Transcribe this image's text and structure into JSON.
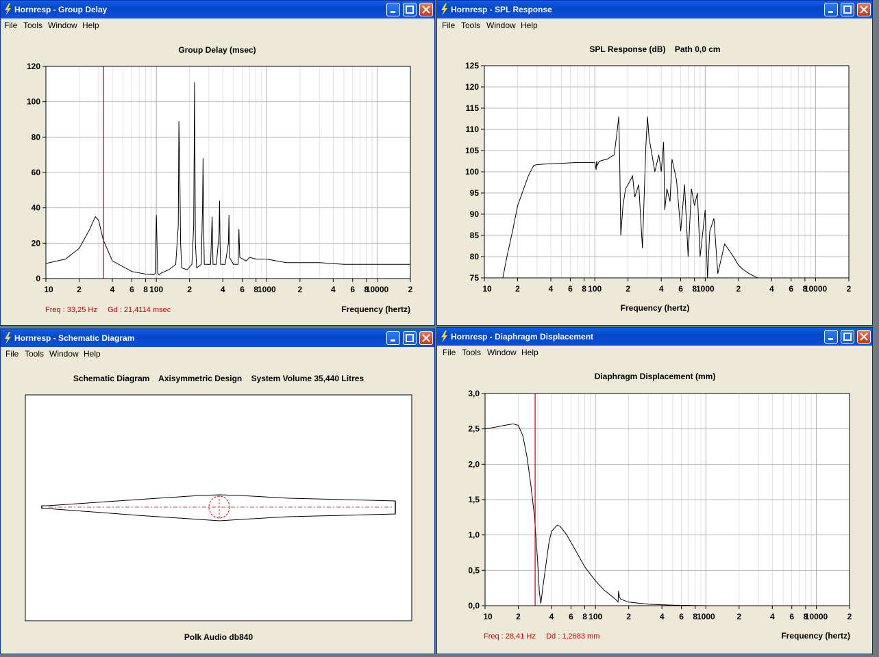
{
  "windows": {
    "gd": {
      "title": "Hornresp - Group Delay",
      "menu": [
        "File",
        "Tools",
        "Window",
        "Help"
      ],
      "chart_title": "Group Delay (msec)",
      "xlabel": "Frequency (hertz)",
      "y_ticks": [
        "120",
        "100",
        "80",
        "60",
        "40",
        "20",
        "0"
      ],
      "x_ticks": [
        "10",
        "2",
        "4",
        "6",
        "8",
        "100",
        "2",
        "4",
        "6",
        "8",
        "1000",
        "2",
        "4",
        "6",
        "8",
        "10000",
        "2"
      ],
      "readout": "Freq : 33,25 Hz     Gd : 21,4114 msec"
    },
    "spl": {
      "title": "Hornresp - SPL Response",
      "menu": [
        "File",
        "Tools",
        "Window",
        "Help"
      ],
      "chart_title": "SPL Response (dB)    Path 0,0 cm",
      "xlabel": "Frequency (hertz)",
      "y_ticks": [
        "125",
        "120",
        "115",
        "110",
        "105",
        "100",
        "95",
        "90",
        "85",
        "80",
        "75"
      ],
      "x_ticks": [
        "10",
        "2",
        "4",
        "6",
        "8",
        "100",
        "2",
        "4",
        "6",
        "8",
        "1000",
        "2",
        "4",
        "6",
        "8",
        "10000",
        "2"
      ]
    },
    "sch": {
      "title": "Hornresp - Schematic Diagram",
      "menu": [
        "File",
        "Tools",
        "Window",
        "Help"
      ],
      "heading": "Schematic Diagram    Axisymmetric Design    System Volume 35,440 Litres",
      "footer": "Polk Audio db840"
    },
    "dd": {
      "title": "Hornresp - Diaphragm Displacement",
      "menu": [
        "File",
        "Tools",
        "Window",
        "Help"
      ],
      "chart_title": "Diaphragm Displacement (mm)",
      "xlabel": "Frequency (hertz)",
      "y_ticks": [
        "3,0",
        "2,5",
        "2,0",
        "1,5",
        "1,0",
        "0,5",
        "0,0"
      ],
      "x_ticks": [
        "10",
        "2",
        "4",
        "6",
        "8",
        "100",
        "2",
        "4",
        "6",
        "8",
        "1000",
        "2",
        "4",
        "6",
        "8",
        "10000",
        "2"
      ],
      "readout": "Freq : 28,41 Hz     Dd : 1,2683 mm"
    }
  },
  "colors": {
    "cursor": "#cc0000",
    "trace": "#000000",
    "readout": "#cc0000",
    "grid": "#c8c8c8"
  },
  "chart_data": [
    {
      "type": "line",
      "title": "Group Delay (msec)",
      "xlabel": "Frequency (hertz)",
      "xscale": "log",
      "xlim": [
        10,
        20000
      ],
      "ylim": [
        0,
        120
      ],
      "grid": true,
      "cursor_x": 33.25,
      "series": [
        {
          "x": [
            10,
            15,
            20,
            25,
            28,
            30,
            33,
            40,
            60,
            80,
            95,
            98,
            100,
            103,
            106,
            110,
            130,
            150,
            158,
            160,
            163,
            166,
            170,
            190,
            210,
            218,
            220,
            222,
            226,
            232,
            255,
            262,
            265,
            268,
            272,
            310,
            320,
            323,
            326,
            350,
            370,
            374,
            378,
            382,
            420,
            450,
            455,
            460,
            500,
            550,
            560,
            570,
            650,
            700,
            800,
            1000,
            1500,
            2000,
            3000,
            5000,
            10000,
            20000
          ],
          "y": [
            8.5,
            11,
            17,
            28,
            35,
            33,
            22,
            10,
            4,
            2.5,
            2.2,
            3,
            36,
            3,
            2,
            3,
            5,
            8,
            30,
            89,
            62,
            20,
            6,
            5,
            8,
            30,
            66,
            111,
            20,
            6,
            8,
            40,
            68,
            30,
            8,
            8,
            35,
            25,
            8,
            8,
            25,
            44,
            20,
            8,
            8,
            20,
            36,
            12,
            8,
            8,
            28,
            12,
            10,
            12,
            11,
            11,
            9,
            9,
            9,
            8,
            8,
            8
          ]
        }
      ]
    },
    {
      "type": "line",
      "title": "SPL Response (dB)    Path 0,0 cm",
      "xlabel": "Frequency (hertz)",
      "xscale": "log",
      "xlim": [
        10,
        20000
      ],
      "ylim": [
        75,
        125
      ],
      "grid": true,
      "series": [
        {
          "x": [
            14.7,
            16,
            18,
            20,
            25,
            28,
            30,
            35,
            50,
            70,
            100,
            103,
            104,
            105,
            110,
            130,
            150,
            160,
            165,
            168,
            172,
            180,
            190,
            200,
            210,
            220,
            230,
            250,
            270,
            290,
            300,
            310,
            330,
            350,
            380,
            400,
            420,
            430,
            450,
            480,
            500,
            550,
            600,
            650,
            700,
            750,
            800,
            850,
            900,
            1000,
            1050,
            1100,
            1200,
            1300,
            1500,
            1800,
            2000,
            2200,
            2500,
            2800,
            3000
          ],
          "y": [
            75,
            80,
            86,
            92,
            99,
            101.5,
            101.7,
            101.8,
            102,
            102.2,
            102.2,
            100.5,
            102.5,
            101.5,
            102.5,
            103,
            104,
            110,
            113,
            103,
            85,
            92,
            96,
            97,
            98,
            99,
            94,
            97,
            82,
            106,
            113,
            108,
            104,
            100,
            104,
            100,
            107,
            91,
            96,
            93,
            103,
            98,
            86,
            97,
            80,
            96,
            92,
            95,
            80,
            91,
            75,
            86,
            89,
            76,
            83,
            80,
            78,
            77,
            76,
            75.3,
            75
          ]
        }
      ]
    },
    {
      "type": "line",
      "title": "Diaphragm Displacement (mm)",
      "xlabel": "Frequency (hertz)",
      "xscale": "log",
      "xlim": [
        10,
        20000
      ],
      "ylim": [
        0,
        3
      ],
      "grid": true,
      "cursor_x": 28.41,
      "series": [
        {
          "x": [
            10,
            12,
            15,
            18,
            20,
            22,
            24,
            26,
            28,
            30,
            31,
            32,
            33,
            35,
            38,
            40,
            45,
            48,
            55,
            65,
            80,
            100,
            120,
            150,
            160,
            162,
            165,
            170,
            200,
            300,
            500,
            800,
            1000,
            2000,
            20000
          ],
          "y": [
            2.5,
            2.52,
            2.55,
            2.57,
            2.55,
            2.4,
            2.1,
            1.7,
            1.27,
            0.6,
            0.2,
            0.03,
            0.2,
            0.5,
            0.9,
            1.05,
            1.14,
            1.12,
            1.0,
            0.8,
            0.55,
            0.35,
            0.22,
            0.1,
            0.05,
            0.21,
            0.12,
            0.09,
            0.05,
            0.02,
            0.008,
            0.003,
            0,
            0,
            0
          ]
        }
      ]
    }
  ]
}
